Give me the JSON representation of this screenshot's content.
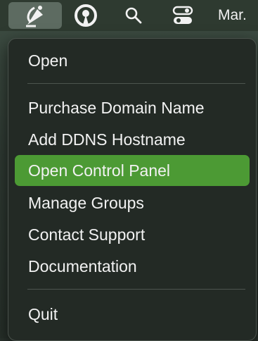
{
  "menubar": {
    "app_icon": "satellite-dish-icon",
    "ddns_icon": "ddns-logo-icon",
    "search_icon": "search-icon",
    "control_center_icon": "control-center-icon",
    "clock_text": "Mar."
  },
  "menu": {
    "items": [
      {
        "label": "Open"
      },
      {
        "label": "Purchase Domain Name"
      },
      {
        "label": "Add DDNS Hostname"
      },
      {
        "label": "Open Control Panel",
        "highlighted": true
      },
      {
        "label": "Manage Groups"
      },
      {
        "label": "Contact Support"
      },
      {
        "label": "Documentation"
      },
      {
        "label": "Quit"
      }
    ]
  },
  "colors": {
    "highlight": "#4c9a34",
    "menu_background": "#232a25",
    "menubar_background": "#2e3a30"
  }
}
